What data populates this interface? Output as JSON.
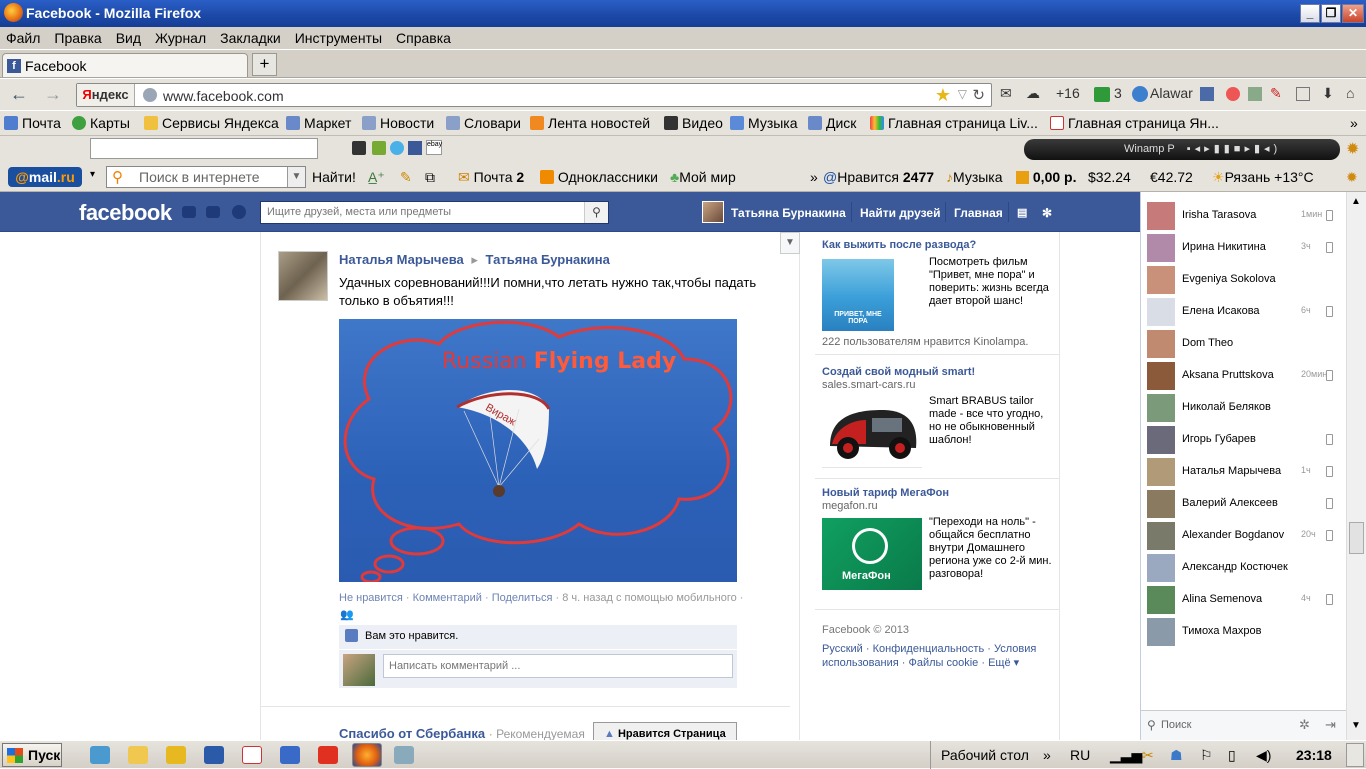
{
  "window": {
    "title": "Facebook - Mozilla Firefox",
    "min": "_",
    "max": "❐",
    "close": "✕"
  },
  "menu": [
    "Файл",
    "Правка",
    "Вид",
    "Журнал",
    "Закладки",
    "Инструменты",
    "Справка"
  ],
  "tab": {
    "label": "Facebook",
    "fav": "f",
    "new_tab": "+"
  },
  "nav": {
    "yandex_logo_a": "Я",
    "yandex_logo_b": "ндекс",
    "url": "www.facebook.com",
    "mail_count": "+16",
    "bonus_count": "3",
    "alawar": "Alawar"
  },
  "bookmarks": [
    "Почта",
    "Карты",
    "Сервисы Яндекса",
    "Маркет",
    "Новости",
    "Словари",
    "Лента новостей",
    "Видео",
    "Музыка",
    "Диск",
    "Главная страница Liv...",
    "Главная страница Ян..."
  ],
  "winamp": {
    "label": "Winamp P"
  },
  "mailbar": {
    "logo_a": "@",
    "logo_b": "mail",
    "logo_c": ".ru",
    "search_placeholder": "Поиск в интернете",
    "find": "Найти!",
    "mail": "Почта",
    "mail_count": "2",
    "ok": "Одноклассники",
    "myworld": "Мой мир",
    "likes": "Нравится",
    "likes_count": "2477",
    "music": "Музыка",
    "money": "0,00 р.",
    "usd": "$32.24",
    "eur": "€42.72",
    "weather": "Рязань +13°C"
  },
  "fb": {
    "logo": "facebook",
    "search_placeholder": "Ищите друзей, места или предметы",
    "user_name": "Татьяна Бурнакина",
    "find_friends": "Найти друзей",
    "home": "Главная"
  },
  "post": {
    "author": "Наталья Марычева",
    "arrow": "▸",
    "target": "Татьяна Бурнакина",
    "text": "Удачных соревнований!!!И помни,что летать нужно так,чтобы падать только в объятия!!!",
    "image_caption_a": "Russian",
    "image_caption_b": "Flying Lady",
    "wing_text": "Вираж",
    "unlike": "Не нравится",
    "comment": "Комментарий",
    "share": "Поделиться",
    "time": "8 ч. назад с помощью мобильного",
    "you_like": "Вам это нравится.",
    "comment_placeholder": "Написать комментарий ..."
  },
  "next_post": {
    "title": "Спасибо от Сбербанка",
    "sponsored": "· Рекомендуемая",
    "like_page": "Нравится Страница"
  },
  "ads": [
    {
      "title": "Как выжить после развода?",
      "text": "Посмотреть фильм \"Привет, мне пора\" и поверить: жизнь всегда дает второй шанс!",
      "footer": "222 пользователям нравится Kinolampa.",
      "img_text": "ПРИВЕТ, МНЕ ПОРА"
    },
    {
      "title": "Создай свой модный smart!",
      "sub": "sales.smart-cars.ru",
      "text": "Smart BRABUS tailor made - все что угодно, но не обыкновенный шаблон!"
    },
    {
      "title": "Новый тариф МегаФон",
      "sub": "megafon.ru",
      "text": "\"Переходи на ноль\" - общайся бесплатно внутри Домашнего региона уже со 2-й мин. разговора!",
      "img_text": "МегаФон"
    }
  ],
  "footer": {
    "copyright": "Facebook © 2013",
    "lang": "Русский",
    "privacy": "Конфиденциальность",
    "terms": "Условия использования",
    "cookies": "Файлы cookie",
    "more": "Ещё"
  },
  "chat": [
    {
      "name": "Irisha Tarasova",
      "time": "1мин",
      "phone": true
    },
    {
      "name": "Ирина Никитина",
      "time": "3ч",
      "phone": true
    },
    {
      "name": "Evgeniya Sokolova",
      "time": "",
      "phone": false
    },
    {
      "name": "Елена Исакова",
      "time": "6ч",
      "phone": true
    },
    {
      "name": "Dom Theo",
      "time": "",
      "phone": false
    },
    {
      "name": "Aksana Pruttskova",
      "time": "20мин",
      "phone": true
    },
    {
      "name": "Николай Беляков",
      "time": "",
      "phone": false
    },
    {
      "name": "Игорь Губарев",
      "time": "",
      "phone": true
    },
    {
      "name": "Наталья Марычева",
      "time": "1ч",
      "phone": true
    },
    {
      "name": "Валерий Алексеев",
      "time": "",
      "phone": true
    },
    {
      "name": "Alexander Bogdanov",
      "time": "20ч",
      "phone": true
    },
    {
      "name": "Александр Костючек",
      "time": "",
      "phone": false
    },
    {
      "name": "Alina Semenova",
      "time": "4ч",
      "phone": true
    },
    {
      "name": "Тимоха Махров",
      "time": "",
      "phone": false
    }
  ],
  "chat_search": "Поиск",
  "taskbar": {
    "start": "Пуск",
    "desktop": "Рабочий стол",
    "lang": "RU",
    "clock": "23:18"
  },
  "colors": {
    "fb_blue": "#3b5998",
    "link": "#3b5998",
    "win_blue": "#1d4aa8"
  }
}
